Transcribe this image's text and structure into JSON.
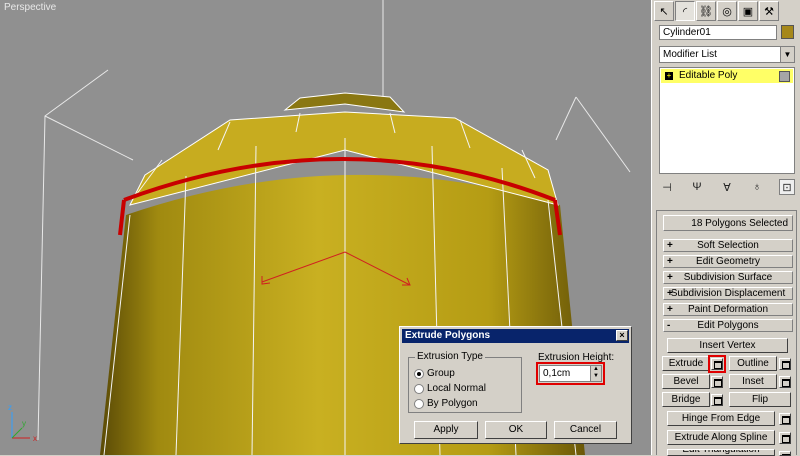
{
  "viewport": {
    "label": "Perspective"
  },
  "command_panel": {
    "tabs": [
      "create-icon",
      "modify-icon",
      "hierarchy-icon",
      "motion-icon",
      "display-icon",
      "utilities-icon"
    ],
    "object_name": "Cylinder01",
    "object_color": "#a6881a",
    "modifier_list": "Modifier List",
    "stack_item": "Editable Poly"
  },
  "rollouts": {
    "selection_info": "18 Polygons Selected",
    "sections": [
      {
        "sign": "+",
        "label": "Soft Selection"
      },
      {
        "sign": "+",
        "label": "Edit Geometry"
      },
      {
        "sign": "+",
        "label": "Subdivision Surface"
      },
      {
        "sign": "+",
        "label": "Subdivision Displacement"
      },
      {
        "sign": "+",
        "label": "Paint Deformation"
      },
      {
        "sign": "-",
        "label": "Edit Polygons"
      }
    ],
    "buttons": {
      "insert_vertex": "Insert Vertex",
      "extrude": "Extrude",
      "outline": "Outline",
      "bevel": "Bevel",
      "inset": "Inset",
      "bridge": "Bridge",
      "flip": "Flip",
      "hinge_from_edge": "Hinge From Edge",
      "extrude_along_spline": "Extrude Along Spline",
      "edit_triangulation": "Edit Triangulation"
    }
  },
  "dialog": {
    "title": "Extrude Polygons",
    "close": "×",
    "extrusion_type_label": "Extrusion Type",
    "options": [
      "Group",
      "Local Normal",
      "By Polygon"
    ],
    "selected_option": "Group",
    "height_label": "Extrusion Height:",
    "height_value": "0,1cm",
    "apply": "Apply",
    "ok": "OK",
    "cancel": "Cancel"
  },
  "colors": {
    "viewport_bg": "#909090",
    "mesh": "#b8a010",
    "selection": "#c80000",
    "selected_item": "#ffff66",
    "title_bar": "#08246b"
  }
}
